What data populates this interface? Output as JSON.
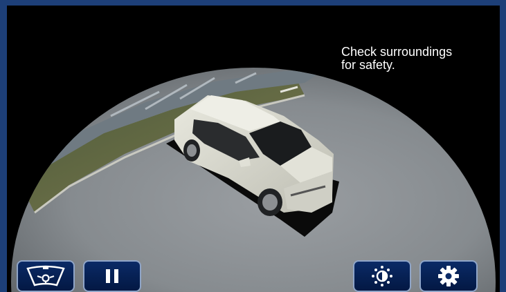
{
  "message": {
    "text": "Check surroundings\nfor safety."
  },
  "controls": [
    {
      "name": "front-view-button",
      "icon": "windshield-icon"
    },
    {
      "name": "pause-button",
      "icon": "pause-icon"
    },
    {
      "name": "brightness-button",
      "icon": "brightness-icon"
    },
    {
      "name": "settings-button",
      "icon": "gear-icon"
    }
  ],
  "colors": {
    "frame": "#1d3f78",
    "button_bg": "#0a2a66",
    "button_border": "#8fa5c8",
    "car": "#dcdcd2",
    "road": "#8a8f93"
  }
}
